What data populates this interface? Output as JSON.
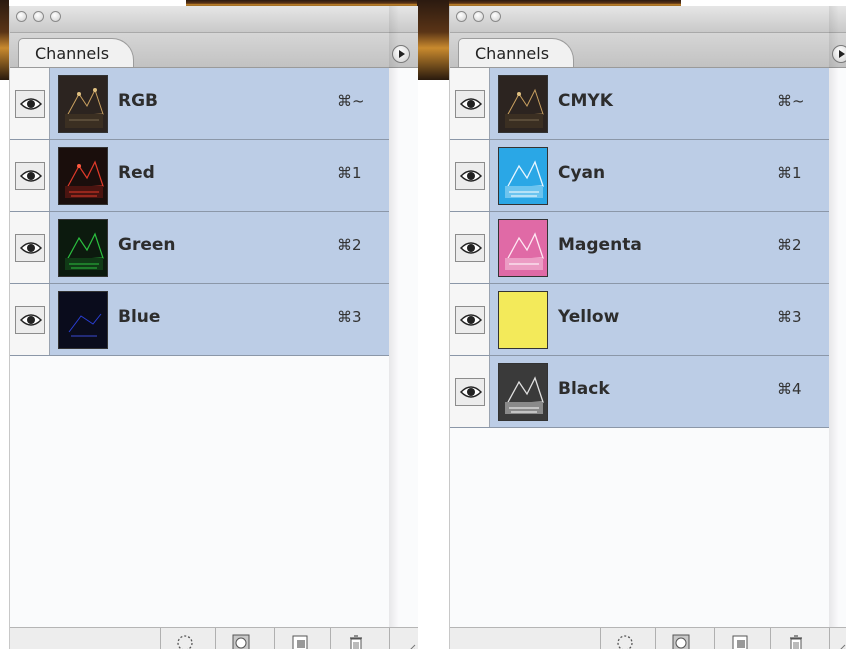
{
  "panels": [
    {
      "tab_label": "Channels",
      "channels": [
        {
          "name": "RGB",
          "shortcut": "⌘~",
          "thumb": "rgb",
          "icon": "eye-icon"
        },
        {
          "name": "Red",
          "shortcut": "⌘1",
          "thumb": "red",
          "icon": "eye-icon"
        },
        {
          "name": "Green",
          "shortcut": "⌘2",
          "thumb": "green",
          "icon": "eye-icon"
        },
        {
          "name": "Blue",
          "shortcut": "⌘3",
          "thumb": "blue",
          "icon": "eye-icon"
        }
      ]
    },
    {
      "tab_label": "Channels",
      "channels": [
        {
          "name": "CMYK",
          "shortcut": "⌘~",
          "thumb": "cmyk",
          "icon": "eye-icon"
        },
        {
          "name": "Cyan",
          "shortcut": "⌘1",
          "thumb": "cyan",
          "icon": "eye-icon"
        },
        {
          "name": "Magenta",
          "shortcut": "⌘2",
          "thumb": "magenta",
          "icon": "eye-icon"
        },
        {
          "name": "Yellow",
          "shortcut": "⌘3",
          "thumb": "yellow",
          "icon": "eye-icon"
        },
        {
          "name": "Black",
          "shortcut": "⌘4",
          "thumb": "black",
          "icon": "eye-icon"
        }
      ]
    }
  ],
  "colors": {
    "row_selected": "#bccde6",
    "panel_bg": "#fafbfc",
    "red": "#e03a2a",
    "green": "#2bbf3f",
    "blue": "#2a3fd6",
    "cyan": "#2aa7e6",
    "magenta": "#e06aa6",
    "yellow": "#f3ea5a"
  },
  "bottom_icons": [
    "load-selection-icon",
    "save-selection-icon",
    "new-channel-icon",
    "trash-icon"
  ]
}
